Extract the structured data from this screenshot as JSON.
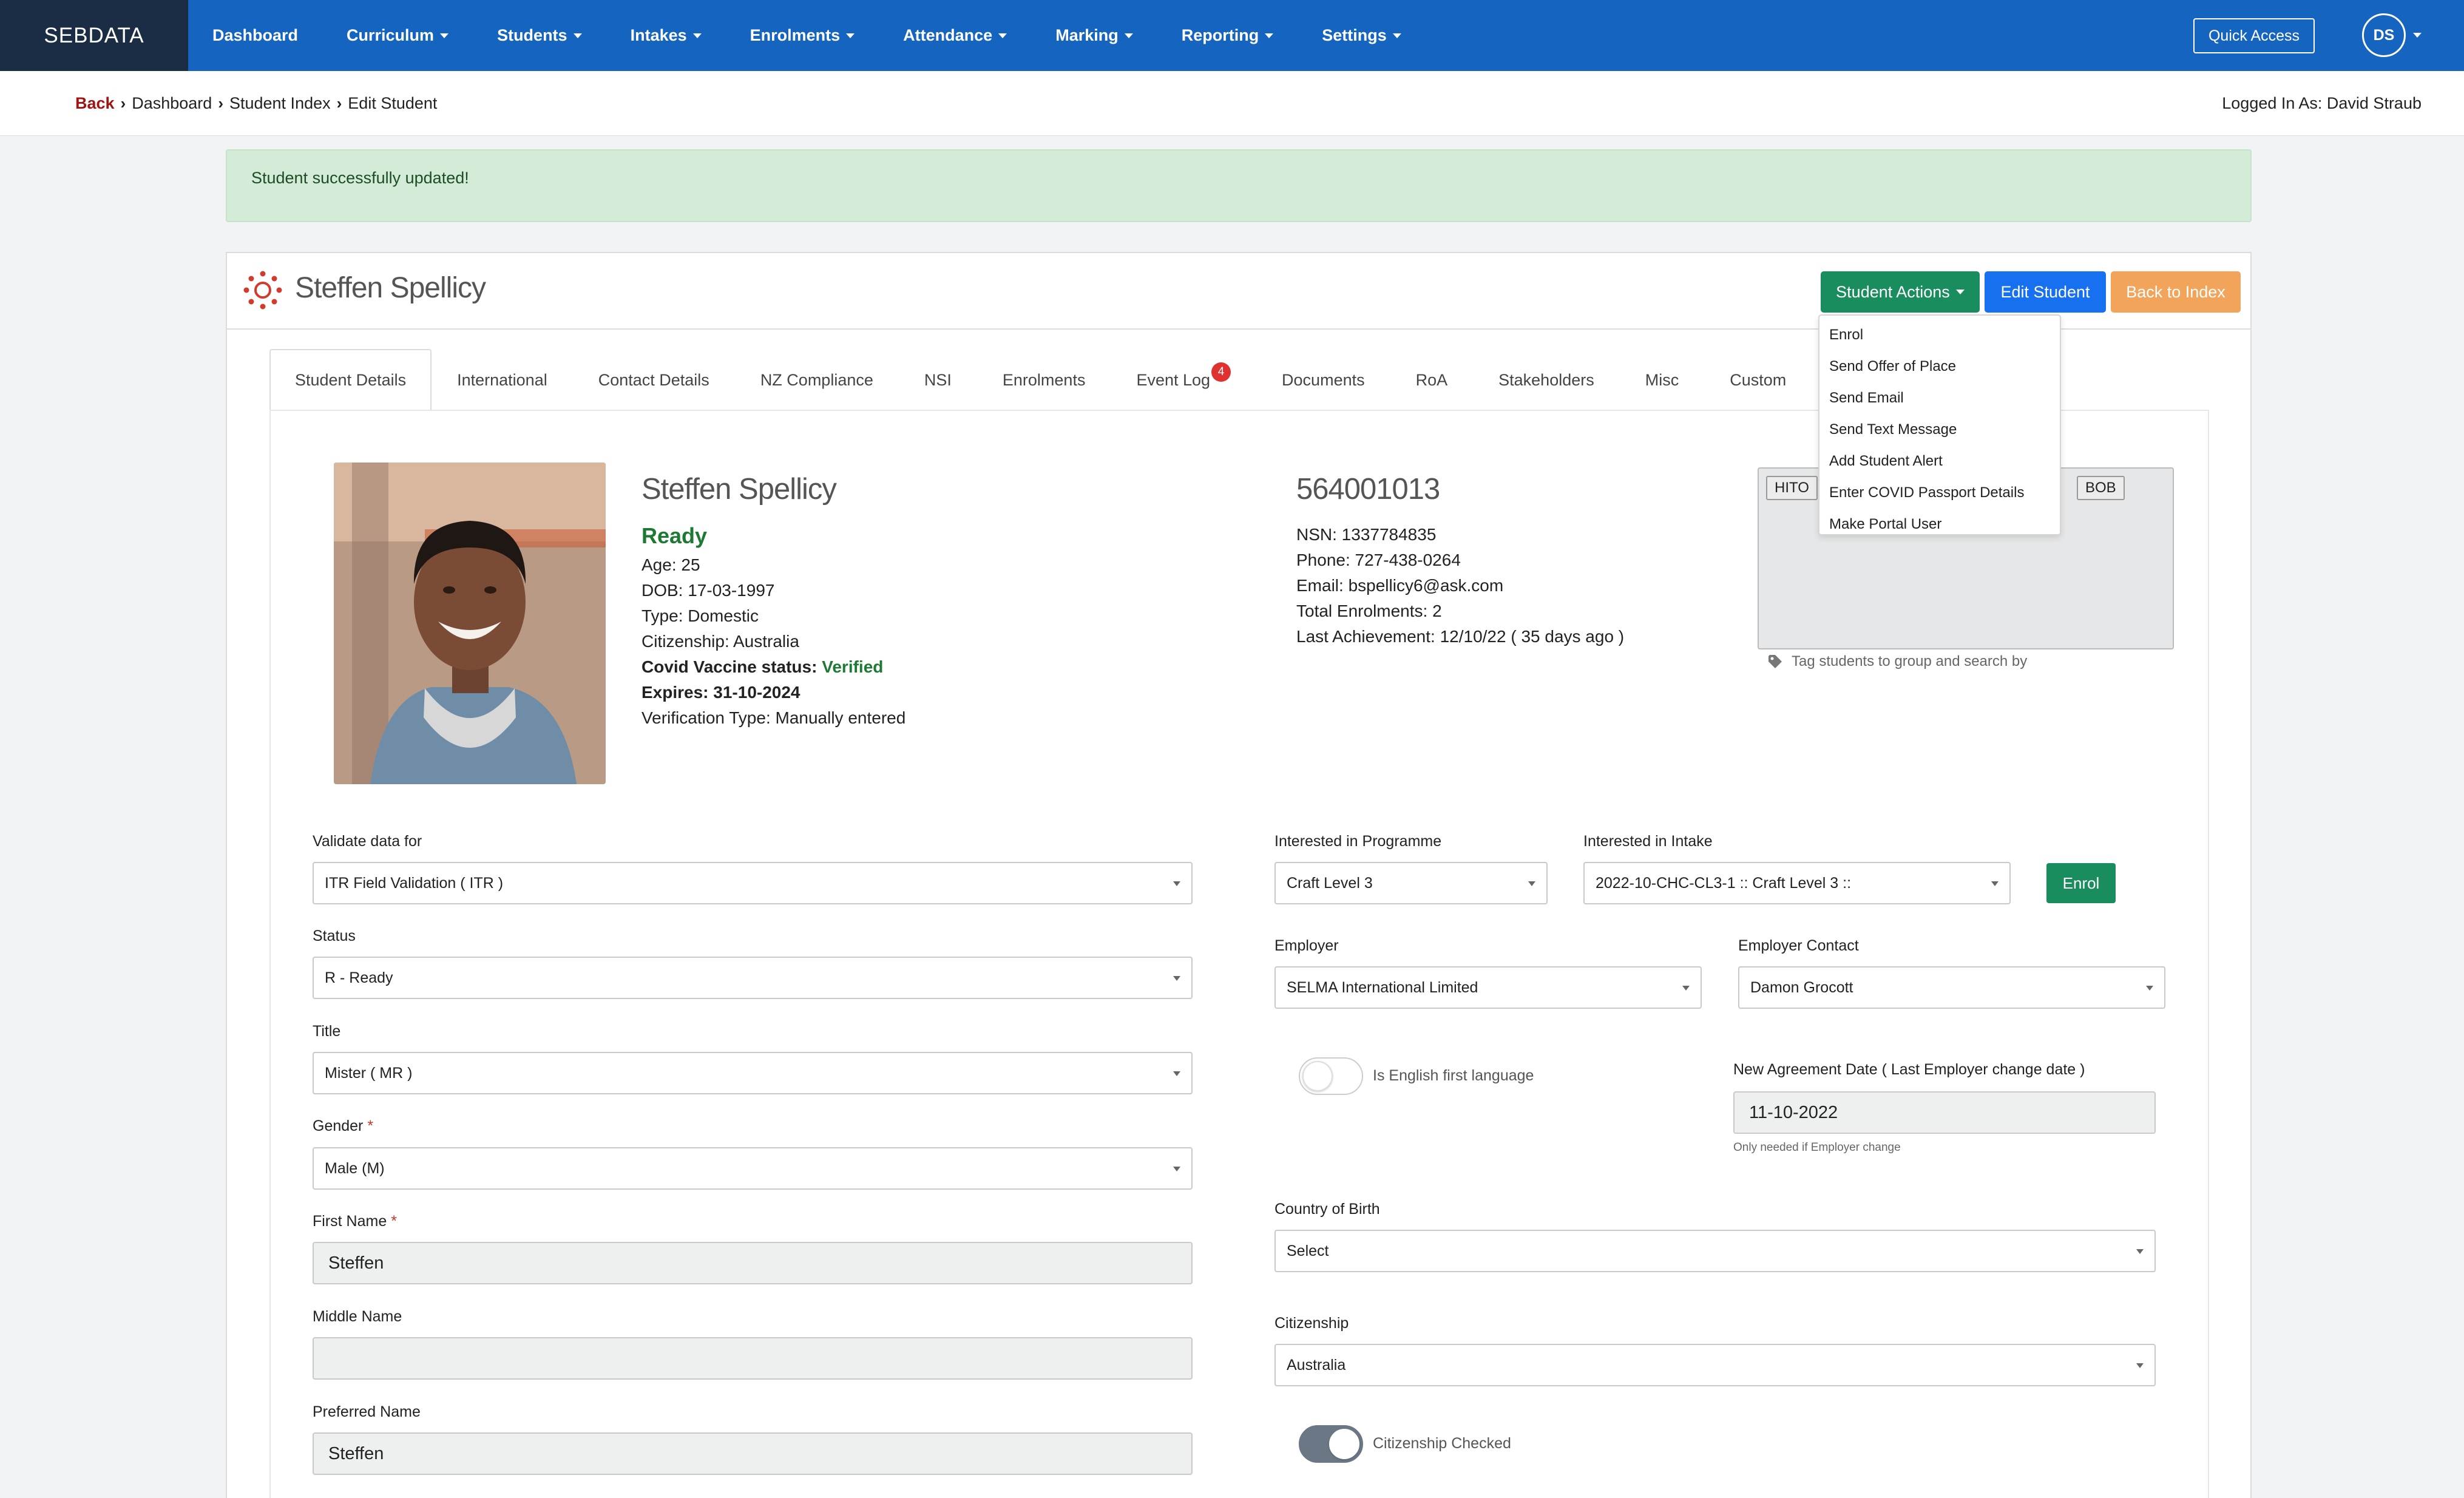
{
  "brand": "SEBDATA",
  "nav": [
    {
      "label": "Dashboard",
      "caret": false
    },
    {
      "label": "Curriculum",
      "caret": true
    },
    {
      "label": "Students",
      "caret": true
    },
    {
      "label": "Intakes",
      "caret": true
    },
    {
      "label": "Enrolments",
      "caret": true
    },
    {
      "label": "Attendance",
      "caret": true
    },
    {
      "label": "Marking",
      "caret": true
    },
    {
      "label": "Reporting",
      "caret": true
    },
    {
      "label": "Settings",
      "caret": true
    }
  ],
  "quick_access": "Quick Access",
  "user_initials": "DS",
  "breadcrumb": {
    "back": "Back",
    "items": [
      "Dashboard",
      "Student Index",
      "Edit Student"
    ]
  },
  "logged_in": "Logged In As: David Straub",
  "alert": "Student successfully updated!",
  "card": {
    "title": "Steffen Spellicy",
    "actions_label": "Student Actions",
    "edit_label": "Edit Student",
    "back_label": "Back to Index"
  },
  "dropdown": [
    "Enrol",
    "Send Offer of Place",
    "Send Email",
    "Send Text Message",
    "Add Student Alert",
    "Enter COVID Passport Details",
    "Make Portal User"
  ],
  "tabs": [
    {
      "label": "Student Details",
      "active": true
    },
    {
      "label": "International"
    },
    {
      "label": "Contact Details"
    },
    {
      "label": "NZ Compliance"
    },
    {
      "label": "NSI"
    },
    {
      "label": "Enrolments"
    },
    {
      "label": "Event Log",
      "badge": "4"
    },
    {
      "label": "Documents"
    },
    {
      "label": "RoA"
    },
    {
      "label": "Stakeholders"
    },
    {
      "label": "Misc"
    },
    {
      "label": "Custom"
    }
  ],
  "profile": {
    "name": "Steffen Spellicy",
    "status": "Ready",
    "age": "Age: 25",
    "dob": "DOB: 17-03-1997",
    "type": "Type: Domestic",
    "citizenship": "Citizenship: Australia",
    "covid_label": "Covid Vaccine status:",
    "covid_value": "Verified",
    "expires": "Expires: 31-10-2024",
    "verification": "Verification Type: Manually entered",
    "student_id": "564001013",
    "nsn": "NSN: 1337784835",
    "phone": "Phone: 727-438-0264",
    "email": "Email: bspellicy6@ask.com",
    "total_enrolments": "Total Enrolments: 2",
    "last_achievement": "Last Achievement: 12/10/22 ( 35 days ago )"
  },
  "tags": {
    "items": [
      "HITO",
      "BOB"
    ],
    "hint": "Tag students to group and search by"
  },
  "form": {
    "validate_label": "Validate data for",
    "validate_value": "ITR Field Validation ( ITR )",
    "status_label": "Status",
    "status_value": "R - Ready",
    "title_label": "Title",
    "title_value": "Mister ( MR )",
    "gender_label": "Gender",
    "gender_value": "Male (M)",
    "first_name_label": "First Name",
    "first_name_value": "Steffen",
    "middle_name_label": "Middle Name",
    "middle_name_value": "",
    "preferred_name_label": "Preferred Name",
    "preferred_name_value": "Steffen",
    "programme_label": "Interested in Programme",
    "programme_value": "Craft Level 3",
    "intake_label": "Interested in Intake",
    "intake_value": "2022-10-CHC-CL3-1 :: Craft Level 3 ::",
    "enrol_label": "Enrol",
    "employer_label": "Employer",
    "employer_value": "SELMA International Limited",
    "employer_contact_label": "Employer Contact",
    "employer_contact_value": "Damon Grocott",
    "english_label": "Is English first language",
    "english_on": false,
    "agreement_label": "New Agreement Date ( Last Employer change date )",
    "agreement_value": "11-10-2022",
    "agreement_help": "Only needed if Employer change",
    "birth_label": "Country of Birth",
    "birth_value": "Select",
    "citizenship_label": "Citizenship",
    "citizenship_value": "Australia",
    "citizenship_checked_label": "Citizenship Checked",
    "citizenship_checked_on": true
  },
  "colors": {
    "nav": "#1565c0",
    "brand_bg": "#1b2d44",
    "success": "#1a8d5f",
    "primary": "#1670f0",
    "warning": "#f2a45a",
    "alert_bg": "#d4ebd8",
    "badge": "#e03131"
  }
}
